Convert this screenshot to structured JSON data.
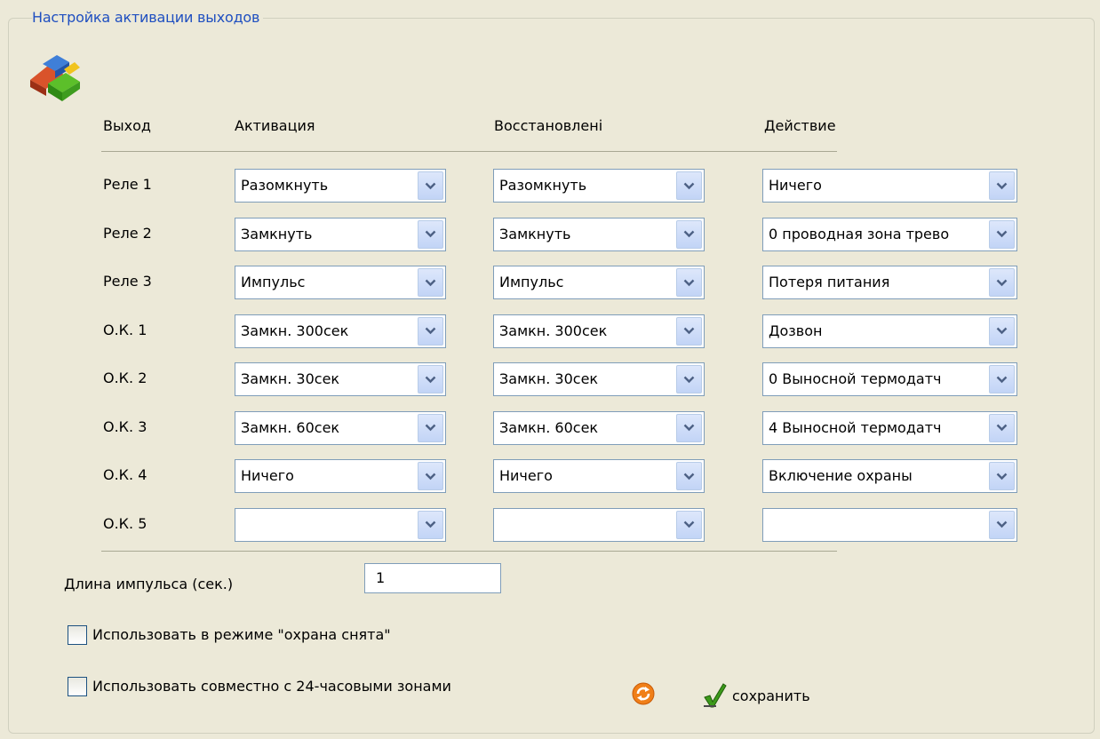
{
  "panel": {
    "title": "Настройка активации выходов",
    "icon": "outputs-puzzle-icon"
  },
  "columns": [
    "Выход",
    "Активация",
    "Восстановлені",
    "Действие"
  ],
  "rows": [
    {
      "output": "Реле 1",
      "activation": "Разомкнуть",
      "restore": "Разомкнуть",
      "action": "Ничего"
    },
    {
      "output": "Реле 2",
      "activation": "Замкнуть",
      "restore": "Замкнуть",
      "action": "0 проводная зона трев⁠о"
    },
    {
      "output": "Реле 3",
      "activation": "Импульс",
      "restore": "Импульс",
      "action": "Потеря питания"
    },
    {
      "output": "О.К. 1",
      "activation": "Замкн. 300сек",
      "restore": "Замкн. 300сек",
      "action": "Дозвон"
    },
    {
      "output": "О.К. 2",
      "activation": "Замкн. 30сек",
      "restore": "Замкн. 30сек",
      "action": "0 Выносной термодатч"
    },
    {
      "output": "О.К. 3",
      "activation": "Замкн. 60сек",
      "restore": "Замкн. 60сек",
      "action": "4 Выносной термодатч"
    },
    {
      "output": "О.К. 4",
      "activation": "Ничего",
      "restore": "Ничего",
      "action": "Включение охраны"
    },
    {
      "output": "О.К. 5",
      "activation": "",
      "restore": "",
      "action": ""
    }
  ],
  "pulse": {
    "label": "Длина импульса (сек.)",
    "value": "1"
  },
  "options": [
    {
      "label": "Использовать в режиме \"охрана снята\"",
      "checked": false
    },
    {
      "label": "Использовать совместно с 24-часовыми зонами",
      "checked": false
    }
  ],
  "footer": {
    "refresh_icon": "refresh-icon",
    "save_icon": "checkmark-icon",
    "save_label": "сохранить"
  },
  "colors": {
    "legend": "#1f4fc0",
    "background": "#ece9d8",
    "select_border": "#7f9db9",
    "arrow": "#4d6185"
  }
}
